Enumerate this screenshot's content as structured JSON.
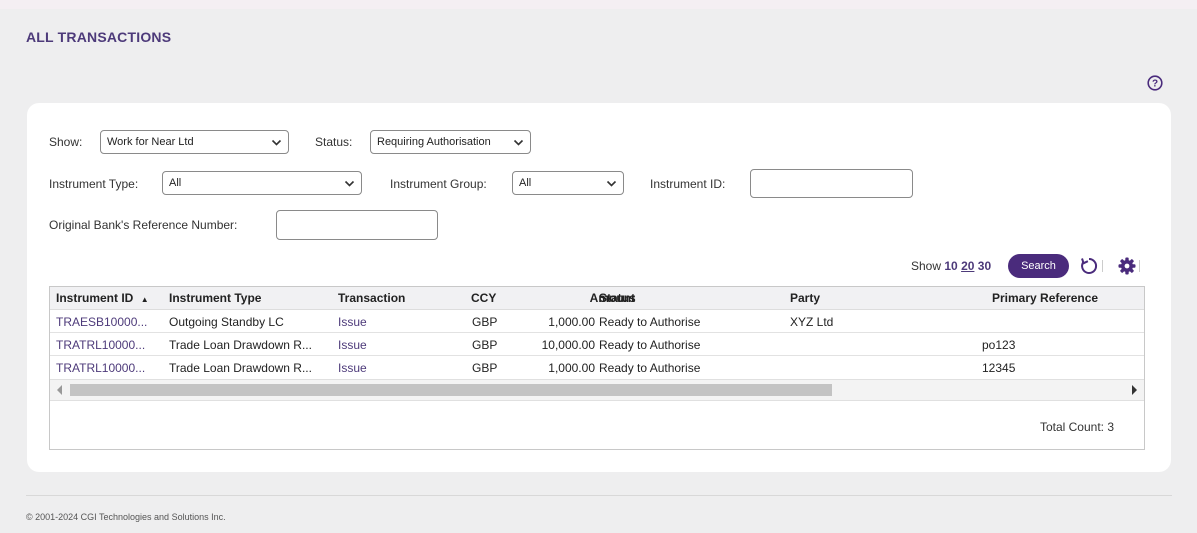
{
  "page": {
    "title": "ALL TRANSACTIONS"
  },
  "colors": {
    "brand": "#4a2b7c",
    "link": "#4d3a7a"
  },
  "filters": {
    "show": {
      "label": "Show:",
      "value": "Work for Near Ltd"
    },
    "status": {
      "label": "Status:",
      "value": "Requiring Authorisation"
    },
    "instrument_type": {
      "label": "Instrument Type:",
      "value": "All"
    },
    "instrument_group": {
      "label": "Instrument Group:",
      "value": "All"
    },
    "instrument_id": {
      "label": "Instrument ID:",
      "value": ""
    },
    "bank_ref": {
      "label": "Original Bank's Reference Number:",
      "value": ""
    }
  },
  "pager": {
    "show_label": "Show",
    "options": [
      "10",
      "20",
      "30"
    ],
    "selected": "20"
  },
  "toolbar": {
    "search_label": "Search",
    "icons": [
      "refresh-icon",
      "gear-icon",
      "help-icon"
    ]
  },
  "table": {
    "columns": [
      "Instrument ID",
      "Instrument Type",
      "Transaction",
      "CCY",
      "Amount",
      "Status",
      "Party",
      "Primary Reference"
    ],
    "sort_indicator": "▲",
    "rows": [
      [
        "TRAESB10000...",
        "Outgoing Standby LC",
        "Issue",
        "GBP",
        "1,000.00",
        "Ready to Authorise",
        "XYZ Ltd",
        ""
      ],
      [
        "TRATRL10000...",
        "Trade Loan Drawdown R...",
        "Issue",
        "GBP",
        "10,000.00",
        "Ready to Authorise",
        "",
        "po123"
      ],
      [
        "TRATRL10000...",
        "Trade Loan Drawdown R...",
        "Issue",
        "GBP",
        "1,000.00",
        "Ready to Authorise",
        "",
        "12345"
      ]
    ],
    "total_count": "Total Count: 3"
  },
  "footer": {
    "copyright": "© 2001-2024 CGI Technologies and Solutions Inc."
  }
}
